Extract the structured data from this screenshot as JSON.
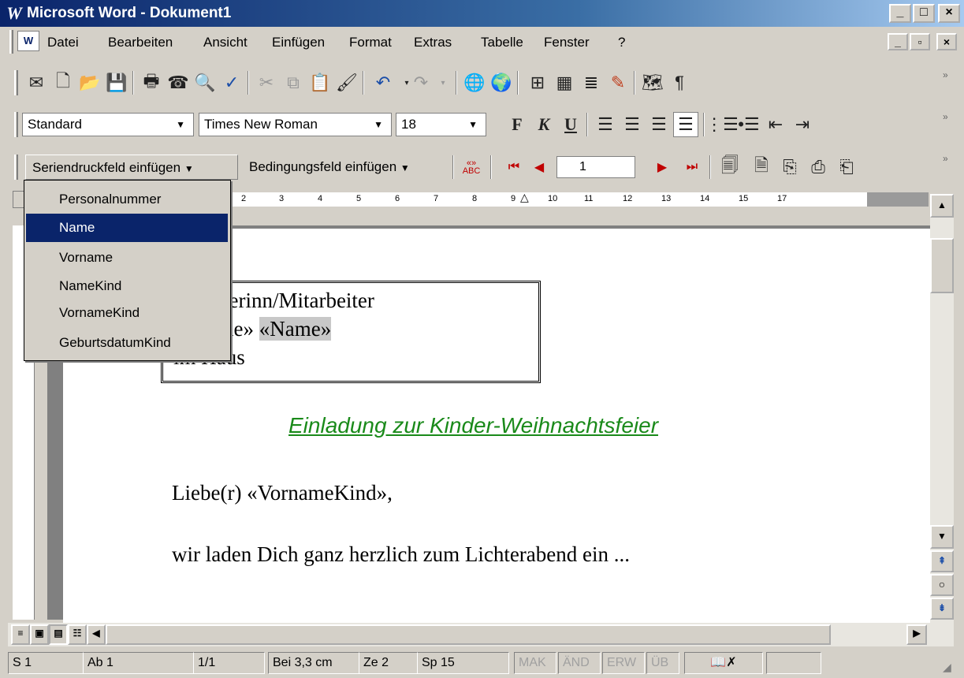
{
  "window": {
    "title": "Microsoft Word - Dokument1"
  },
  "menu": {
    "items": [
      "Datei",
      "Bearbeiten",
      "Ansicht",
      "Einfügen",
      "Format",
      "Extras",
      "Tabelle",
      "Fenster",
      "?"
    ]
  },
  "formatting": {
    "style": "Standard",
    "font": "Times New Roman",
    "size": "18",
    "bold": "F",
    "italic": "K",
    "underline": "U"
  },
  "mailmerge": {
    "insert_field_label": "Seriendruckfeld einfügen",
    "condition_field_label": "Bedingungsfeld einfügen",
    "record_number": "1"
  },
  "dropdown": {
    "items": [
      "Personalnummer",
      "Name",
      "Vorname",
      "NameKind",
      "VornameKind",
      "GeburtsdatumKind"
    ],
    "selected": "Name"
  },
  "ruler": {
    "numbers": [
      "2",
      "3",
      "4",
      "5",
      "6",
      "7",
      "8",
      "9",
      "10",
      "11",
      "12",
      "13",
      "14",
      "15",
      "17"
    ]
  },
  "document": {
    "address_line1": "beiterinn/Mitarbeiter",
    "address_line2_a": "name» ",
    "address_line2_b": "«Name»",
    "address_line3": "im Haus",
    "heading": "Einladung zur Kinder-Weihnachtsfeier",
    "greeting": "Liebe(r) «VornameKind»,",
    "body": "wir laden Dich ganz herzlich zum Lichterabend ein ..."
  },
  "statusbar": {
    "page": "S 1",
    "section": "Ab 1",
    "pages": "1/1",
    "position": "Bei 3,3 cm",
    "line": "Ze 2",
    "column": "Sp 15",
    "mak": "MAK",
    "aend": "ÄND",
    "erw": "ERW",
    "ueb": "ÜB"
  },
  "colors": {
    "title_bar": "#0a246a",
    "highlight": "#0a246a",
    "heading_green": "#1a8a1a",
    "face": "#d4d0c8"
  }
}
